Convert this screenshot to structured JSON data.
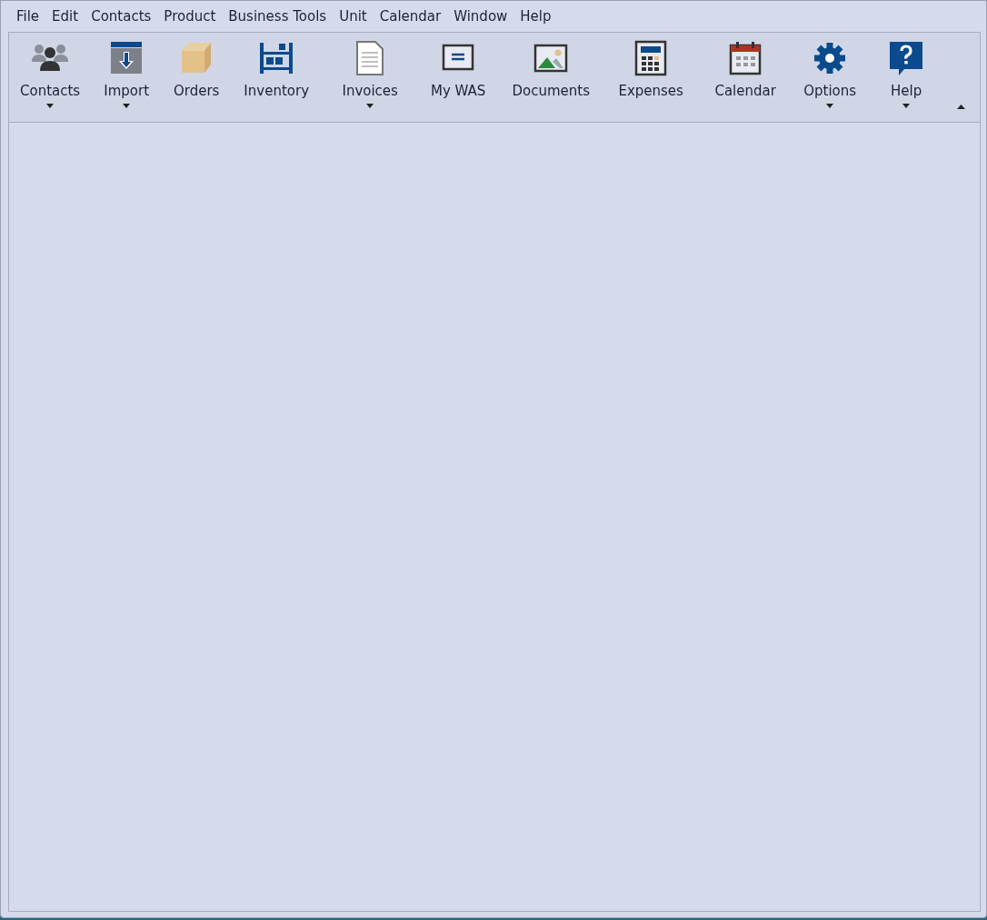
{
  "menu": [
    "File",
    "Edit",
    "Contacts",
    "Product",
    "Business Tools",
    "Unit",
    "Calendar",
    "Window",
    "Help"
  ],
  "ribbon": {
    "items": [
      {
        "label": "Contacts",
        "kind": "people",
        "dropdown": true
      },
      {
        "label": "Import",
        "kind": "import",
        "dropdown": true
      },
      {
        "label": "Orders",
        "kind": "box",
        "dropdown": false
      },
      {
        "label": "Inventory",
        "kind": "shelf",
        "dropdown": false
      },
      {
        "label": "Invoices",
        "kind": "document",
        "dropdown": true
      },
      {
        "label": "My WAS",
        "kind": "panel",
        "dropdown": false
      },
      {
        "label": "Documents",
        "kind": "image",
        "dropdown": false
      },
      {
        "label": "Expenses",
        "kind": "calculator",
        "dropdown": false
      },
      {
        "label": "Calendar",
        "kind": "calendar",
        "dropdown": false
      },
      {
        "label": "Options",
        "kind": "gear",
        "dropdown": true
      },
      {
        "label": "Help",
        "kind": "help",
        "dropdown": true
      }
    ],
    "collapse": true
  }
}
